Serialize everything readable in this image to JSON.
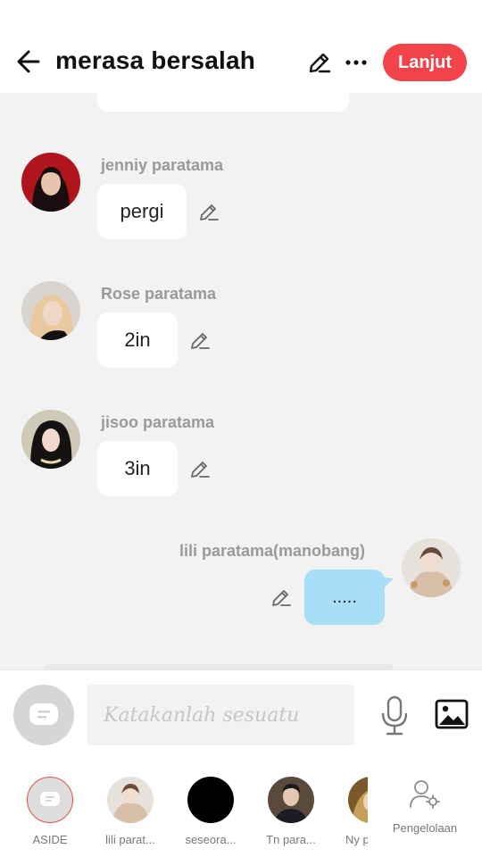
{
  "header": {
    "title": "merasa bersalah",
    "next_label": "Lanjut"
  },
  "messages": [
    {
      "sender": "jenniy paratama",
      "text": "pergi"
    },
    {
      "sender": "Rose paratama",
      "text": "2in"
    },
    {
      "sender": "jisoo paratama",
      "text": "3in"
    },
    {
      "sender": "lili paratama(manobang)",
      "text": "....."
    }
  ],
  "input": {
    "placeholder": "Katakanlah sesuatu"
  },
  "characters": [
    {
      "label": "ASIDE"
    },
    {
      "label": "lili parat..."
    },
    {
      "label": "seseora..."
    },
    {
      "label": "Tn para..."
    },
    {
      "label": "Ny p"
    }
  ],
  "manage_label": "Pengelolaan",
  "colors": {
    "accent": "#f2434a",
    "own_bubble": "#a9def9",
    "background": "#f2f2f2"
  },
  "icons": [
    "back-arrow-icon",
    "pencil-icon",
    "more-dots-icon",
    "aside-chat-icon",
    "microphone-icon",
    "image-icon",
    "user-settings-icon"
  ]
}
